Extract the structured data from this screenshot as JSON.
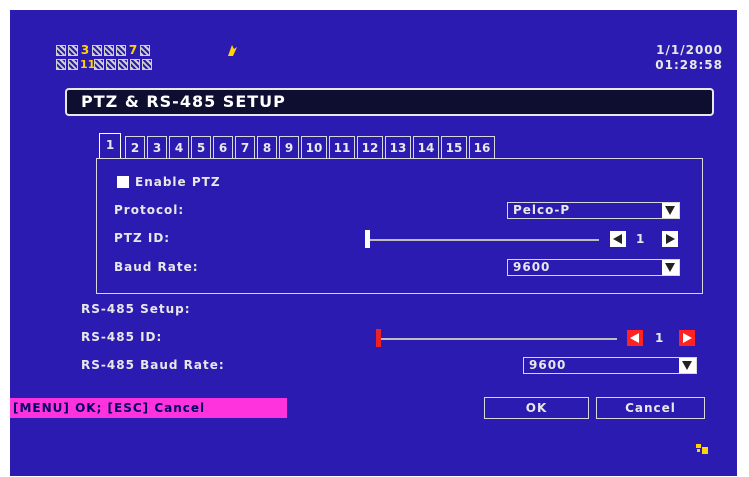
{
  "status": {
    "row1_highlights": [
      "3",
      "7"
    ],
    "row2_highlight": "11",
    "date": "1/1/2000",
    "time": "01:28:58"
  },
  "title": "PTZ & RS-485 SETUP",
  "tabs": [
    "1",
    "2",
    "3",
    "4",
    "5",
    "6",
    "7",
    "8",
    "9",
    "10",
    "11",
    "12",
    "13",
    "14",
    "15",
    "16"
  ],
  "active_tab": "1",
  "ptz": {
    "enable_label": "Enable PTZ",
    "enabled": true,
    "protocol_label": "Protocol:",
    "protocol_value": "Pelco-P",
    "id_label": "PTZ ID:",
    "id_value": "1",
    "baud_label": "Baud Rate:",
    "baud_value": "9600"
  },
  "rs485": {
    "section_label": "RS-485 Setup:",
    "id_label": "RS-485 ID:",
    "id_value": "1",
    "baud_label": "RS-485 Baud Rate:",
    "baud_value": "9600"
  },
  "footer": {
    "hint": "[MENU] OK; [ESC] Cancel",
    "ok_label": "OK",
    "cancel_label": "Cancel"
  },
  "colors": {
    "background": "#2c1bb0",
    "hint_bg": "#ff33dd",
    "accent_red": "#ff2222",
    "highlight": "#ffd400"
  }
}
